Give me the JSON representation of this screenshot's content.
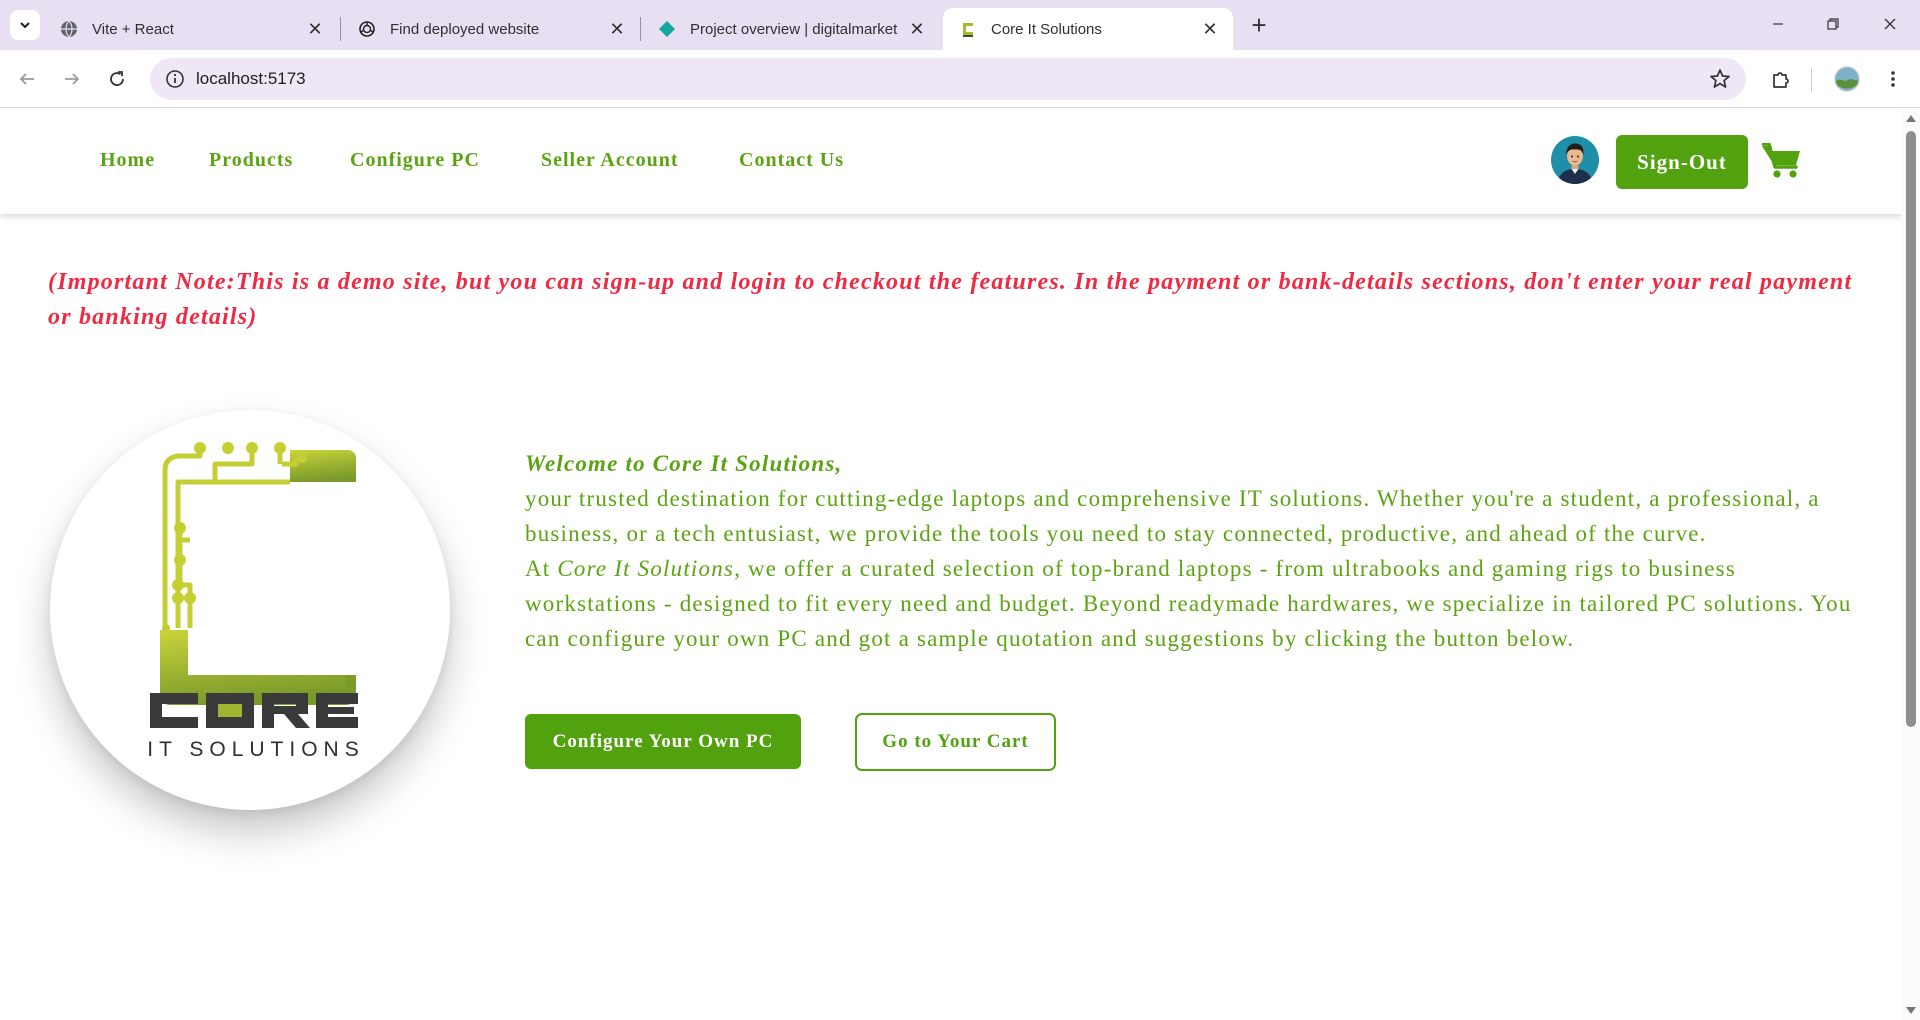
{
  "browser": {
    "tabs": [
      {
        "title": "Vite + React",
        "icon": "globe-icon"
      },
      {
        "title": "Find deployed website",
        "icon": "openai-icon"
      },
      {
        "title": "Project overview | digitalmarket",
        "icon": "diamond-icon"
      },
      {
        "title": "Core It Solutions",
        "icon": "core-favicon",
        "active": true
      }
    ],
    "new_tab_label": "+",
    "url": "localhost:5173"
  },
  "site": {
    "nav": {
      "home": "Home",
      "products": "Products",
      "configure": "Configure PC",
      "seller": "Seller Account",
      "contact": "Contact Us"
    },
    "signout_label": "Sign-Out",
    "note": "(Important Note:This is a demo site, but you can sign-up and login to checkout the features. In the payment or bank-details sections, don't enter your real payment or banking details)",
    "logo": {
      "word": "CORE",
      "tagline": "IT SOLUTIONS"
    },
    "intro": {
      "welcome": "Welcome to Core It Solutions,",
      "line1": "your trusted destination for cutting-edge laptops and comprehensive IT solutions. Whether you're a student, a professional, a business, or a tech entusiast, we provide the tools you need to stay connected, productive, and ahead of the curve.",
      "at": "At",
      "brand": "Core It Solutions,",
      "line2": "we offer a curated selection of top-brand laptops - from ultrabooks and gaming rigs to business workstations - designed to fit every need and budget. Beyond readymade hardwares, we specialize in tailored PC solutions. You can configure your own PC and got a sample quotation and suggestions by clicking the button below."
    },
    "buttons": {
      "configure": "Configure Your Own PC",
      "cart": "Go to Your Cart"
    }
  },
  "colors": {
    "brand_green": "#52a10e",
    "note_red": "#f02a42",
    "tabstrip": "#e9dff3"
  }
}
